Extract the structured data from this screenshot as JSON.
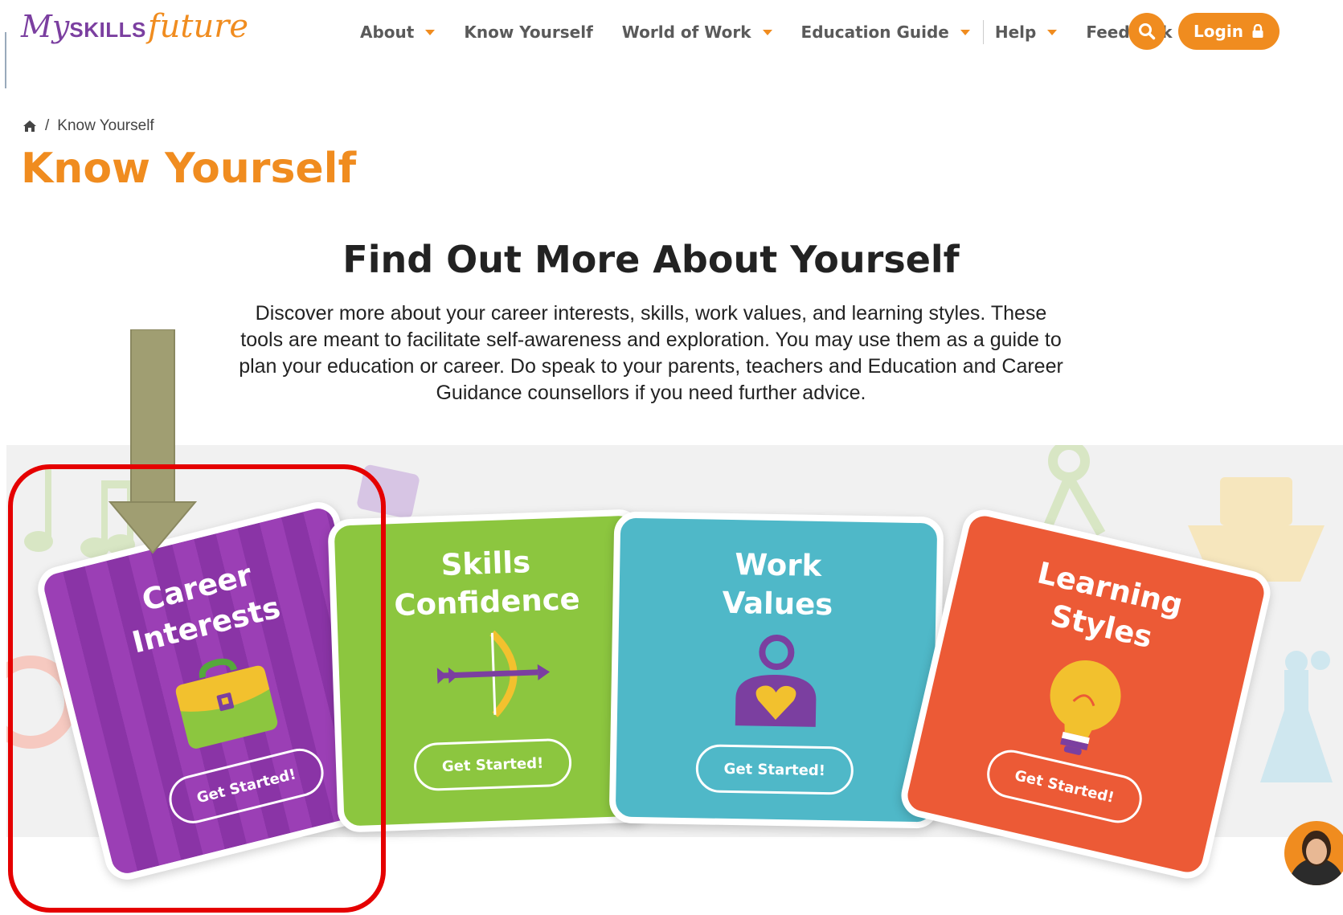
{
  "logo": {
    "part1": "My",
    "part2": "SKILLS",
    "part3": "future"
  },
  "nav": {
    "items": [
      {
        "label": "About",
        "dropdown": true
      },
      {
        "label": "Know Yourself",
        "dropdown": false
      },
      {
        "label": "World of Work",
        "dropdown": true
      },
      {
        "label": "Education Guide",
        "dropdown": true
      },
      {
        "label": "Help",
        "dropdown": true
      },
      {
        "label": "Feedback",
        "dropdown": false
      }
    ],
    "search_icon": "search-icon",
    "login_label": "Login",
    "login_icon": "lock-icon"
  },
  "breadcrumb": {
    "home_icon": "home-icon",
    "separator": "/",
    "current": "Know Yourself"
  },
  "page": {
    "title": "Know Yourself",
    "section_title": "Find Out More About Yourself",
    "description": "Discover more about your career interests, skills, work values, and learning styles. These tools are meant to facilitate self-awareness and exploration. You may use them as a guide to plan your education or career. Do speak to your parents, teachers and Education and Career Guidance counsellors if you need further advice."
  },
  "cards": [
    {
      "title_line1": "Career",
      "title_line2": "Interests",
      "button": "Get Started!",
      "icon": "briefcase-icon",
      "color": "#9b3fb5"
    },
    {
      "title_line1": "Skills",
      "title_line2": "Confidence",
      "button": "Get Started!",
      "icon": "bow-and-arrow-icon",
      "color": "#8cc63f"
    },
    {
      "title_line1": "Work",
      "title_line2": "Values",
      "button": "Get Started!",
      "icon": "person-heart-icon",
      "color": "#4fb8c8"
    },
    {
      "title_line1": "Learning",
      "title_line2": "Styles",
      "button": "Get Started!",
      "icon": "lightbulb-icon",
      "color": "#ec5a36"
    }
  ],
  "colors": {
    "brand_orange": "#f08c1f",
    "brand_purple": "#7b3fa0",
    "annotation_red": "#e50000",
    "annotation_arrow": "#a09e72"
  }
}
